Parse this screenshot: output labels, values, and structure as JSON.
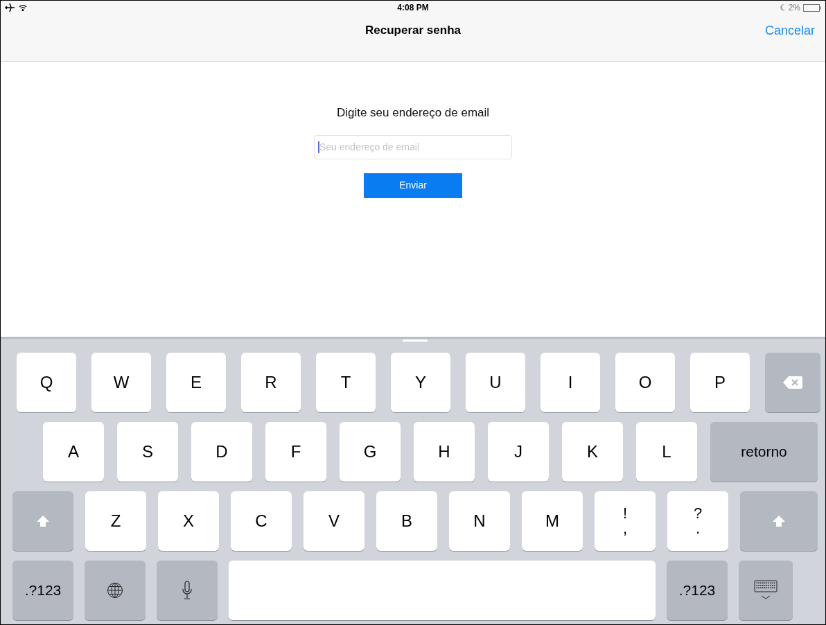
{
  "status_bar": {
    "time": "4:08 PM",
    "battery": "2%"
  },
  "nav_bar": {
    "title": "Recuperar senha",
    "cancel": "Cancelar"
  },
  "form": {
    "prompt": "Digite seu endereço de email",
    "email_field": {
      "placeholder": "Seu endereço de email",
      "focused": true
    },
    "submit": "Enviar"
  },
  "keyboard": {
    "rows": [
      [
        {
          "kind": "letter",
          "label": "Q"
        },
        {
          "kind": "letter",
          "label": "W"
        },
        {
          "kind": "letter",
          "label": "E"
        },
        {
          "kind": "letter",
          "label": "R"
        },
        {
          "kind": "letter",
          "label": "T"
        },
        {
          "kind": "letter",
          "label": "Y"
        },
        {
          "kind": "letter",
          "label": "U"
        },
        {
          "kind": "letter",
          "label": "I"
        },
        {
          "kind": "letter",
          "label": "O"
        },
        {
          "kind": "letter",
          "label": "P"
        },
        {
          "kind": "backspace"
        }
      ],
      [
        {
          "kind": "letter",
          "label": "A"
        },
        {
          "kind": "letter",
          "label": "S"
        },
        {
          "kind": "letter",
          "label": "D"
        },
        {
          "kind": "letter",
          "label": "F"
        },
        {
          "kind": "letter",
          "label": "G"
        },
        {
          "kind": "letter",
          "label": "H"
        },
        {
          "kind": "letter",
          "label": "J"
        },
        {
          "kind": "letter",
          "label": "K"
        },
        {
          "kind": "letter",
          "label": "L"
        },
        {
          "kind": "action",
          "label": "retorno"
        }
      ],
      [
        {
          "kind": "shift"
        },
        {
          "kind": "letter",
          "label": "Z"
        },
        {
          "kind": "letter",
          "label": "X"
        },
        {
          "kind": "letter",
          "label": "C"
        },
        {
          "kind": "letter",
          "label": "V"
        },
        {
          "kind": "letter",
          "label": "B"
        },
        {
          "kind": "letter",
          "label": "N"
        },
        {
          "kind": "letter",
          "label": "M"
        },
        {
          "kind": "punct",
          "top": "!",
          "bottom": ","
        },
        {
          "kind": "punct",
          "top": "?",
          "bottom": "."
        },
        {
          "kind": "shift"
        }
      ],
      [
        {
          "kind": "action",
          "label": ".?123"
        },
        {
          "kind": "globe"
        },
        {
          "kind": "mic"
        },
        {
          "kind": "space"
        },
        {
          "kind": "action",
          "label": ".?123"
        },
        {
          "kind": "hide"
        }
      ]
    ]
  }
}
